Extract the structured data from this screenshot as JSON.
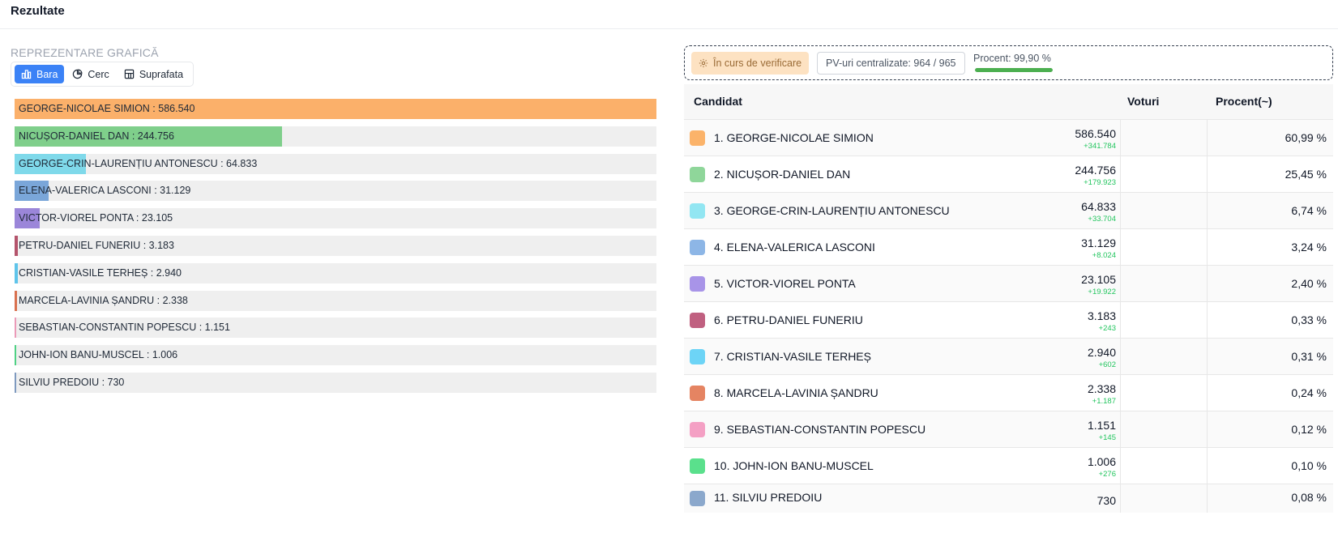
{
  "header": {
    "title": "Rezultate"
  },
  "chart_panel": {
    "section_label": "REPREZENTARE GRAFICĂ",
    "chart_types": [
      {
        "label": "Bara",
        "icon": "bar-chart-icon",
        "active": true
      },
      {
        "label": "Cerc",
        "icon": "pie-chart-icon",
        "active": false
      },
      {
        "label": "Suprafata",
        "icon": "area-chart-icon",
        "active": false
      }
    ]
  },
  "status": {
    "verification_label": "În curs de verificare",
    "pv_label": "PV-uri centralizate: 964 / 965",
    "percent_label": "Procent: 99,90 %",
    "percent_value": 99.9
  },
  "table": {
    "headers": {
      "candidate": "Candidat",
      "votes": "Voturi",
      "percent": "Procent(~)"
    },
    "rows": [
      {
        "name": "1. GEORGE-NICOLAE SIMION",
        "votes": "586.540",
        "delta": "+341.784",
        "percent": "60,99 %",
        "color": "#fbb36a"
      },
      {
        "name": "2. NICUȘOR-DANIEL DAN",
        "votes": "244.756",
        "delta": "+179.923",
        "percent": "25,45 %",
        "color": "#8fd69a"
      },
      {
        "name": "3. GEORGE-CRIN-LAURENȚIU ANTONESCU",
        "votes": "64.833",
        "delta": "+33.704",
        "percent": "6,74 %",
        "color": "#92e6f2"
      },
      {
        "name": "4. ELENA-VALERICA LASCONI",
        "votes": "31.129",
        "delta": "+8.024",
        "percent": "3,24 %",
        "color": "#8db6e6"
      },
      {
        "name": "5. VICTOR-VIOREL PONTA",
        "votes": "23.105",
        "delta": "+19.922",
        "percent": "2,40 %",
        "color": "#a894e8"
      },
      {
        "name": "6. PETRU-DANIEL FUNERIU",
        "votes": "3.183",
        "delta": "+243",
        "percent": "0,33 %",
        "color": "#c06080"
      },
      {
        "name": "7. CRISTIAN-VASILE TERHEȘ",
        "votes": "2.940",
        "delta": "+602",
        "percent": "0,31 %",
        "color": "#6dd4f6"
      },
      {
        "name": "8. MARCELA-LAVINIA ȘANDRU",
        "votes": "2.338",
        "delta": "+1.187",
        "percent": "0,24 %",
        "color": "#e58462"
      },
      {
        "name": "9. SEBASTIAN-CONSTANTIN POPESCU",
        "votes": "1.151",
        "delta": "+145",
        "percent": "0,12 %",
        "color": "#f4a0c4"
      },
      {
        "name": "10. JOHN-ION BANU-MUSCEL",
        "votes": "1.006",
        "delta": "+276",
        "percent": "0,10 %",
        "color": "#5ae08c"
      },
      {
        "name": "11. SILVIU PREDOIU",
        "votes": "730",
        "delta": "",
        "percent": "0,08 %",
        "color": "#8ba8cc"
      }
    ]
  },
  "chart_data": {
    "type": "bar",
    "orientation": "horizontal",
    "categories": [
      "GEORGE-NICOLAE SIMION",
      "NICUȘOR-DANIEL DAN",
      "GEORGE-CRIN-LAURENȚIU ANTONESCU",
      "ELENA-VALERICA LASCONI",
      "VICTOR-VIOREL PONTA",
      "PETRU-DANIEL FUNERIU",
      "CRISTIAN-VASILE TERHEȘ",
      "MARCELA-LAVINIA ȘANDRU",
      "SEBASTIAN-CONSTANTIN POPESCU",
      "JOHN-ION BANU-MUSCEL",
      "SILVIU PREDOIU"
    ],
    "values": [
      586540,
      244756,
      64833,
      31129,
      23105,
      3183,
      2940,
      2338,
      1151,
      1006,
      730
    ],
    "value_labels": [
      "586.540",
      "244.756",
      "64.833",
      "31.129",
      "23.105",
      "3.183",
      "2.940",
      "2.338",
      "1.151",
      "1.006",
      "730"
    ],
    "colors": [
      "#fbb06a",
      "#7fcf8b",
      "#7fd9ea",
      "#7aa6d9",
      "#9b86d9",
      "#b4546c",
      "#5fc4ea",
      "#d9714f",
      "#eb9ab8",
      "#4fd184",
      "#7f9abf"
    ],
    "xlim": [
      0,
      586540
    ],
    "grid": false
  }
}
